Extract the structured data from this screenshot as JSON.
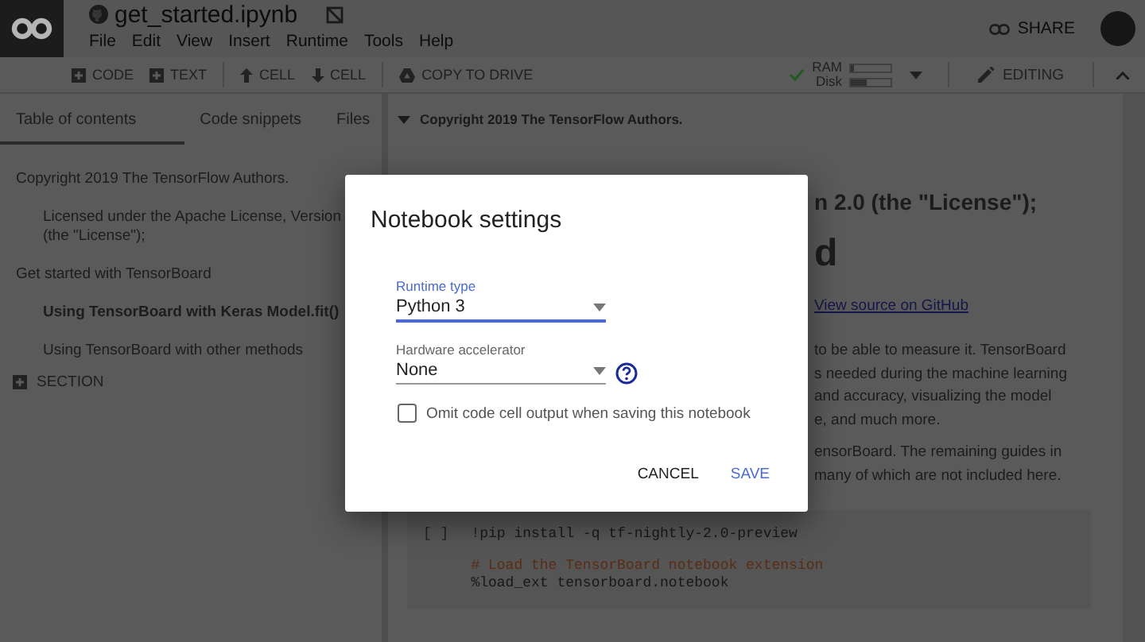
{
  "header": {
    "title": "get_started.ipynb",
    "menu": [
      "File",
      "Edit",
      "View",
      "Insert",
      "Runtime",
      "Tools",
      "Help"
    ],
    "share": "SHARE"
  },
  "toolbar": {
    "items": [
      {
        "kind": "add",
        "label": "CODE"
      },
      {
        "kind": "add",
        "label": "TEXT"
      },
      {
        "kind": "up",
        "label": "CELL"
      },
      {
        "kind": "down",
        "label": "CELL"
      },
      {
        "kind": "drive",
        "label": "COPY TO DRIVE"
      }
    ],
    "connected": true,
    "resources": [
      {
        "label": "RAM",
        "level": 0.05
      },
      {
        "label": "Disk",
        "level": 0.4
      }
    ],
    "mode": "EDITING"
  },
  "sidebar": {
    "tabs": [
      {
        "label": "Table of contents",
        "selected": true
      },
      {
        "label": "Code snippets",
        "selected": false
      },
      {
        "label": "Files",
        "selected": false
      }
    ],
    "toc": [
      {
        "text": "Copyright 2019 The TensorFlow Authors.",
        "selected": false,
        "children": [
          {
            "text": "Licensed under the Apache License, Version\n(the \"License\");",
            "selected": false
          }
        ]
      },
      {
        "text": "Get started with TensorBoard",
        "selected": false,
        "children": [
          {
            "text": "Using TensorBoard with Keras Model.fit()",
            "selected": true
          },
          {
            "text": "Using TensorBoard with other methods",
            "selected": false
          }
        ]
      }
    ],
    "add_section": "SECTION"
  },
  "notebook": {
    "section": {
      "title": "Copyright 2019 The TensorFlow Authors.",
      "expanded": true
    },
    "fragments": [
      {
        "kind": "bold",
        "text": "n 2.0 (the \"License\");"
      },
      {
        "kind": "heading",
        "text": "d"
      },
      {
        "kind": "link",
        "text": "View source on GitHub"
      },
      {
        "kind": "text",
        "text": "to be able to measure it. TensorBoard"
      },
      {
        "kind": "text",
        "text": "s needed during the machine learning"
      },
      {
        "kind": "text",
        "text": "and accuracy, visualizing the model"
      },
      {
        "kind": "text",
        "text": "e, and much more."
      },
      {
        "kind": "gap",
        "text": "ensorBoard. The remaining guides in"
      },
      {
        "kind": "text",
        "text": "many of which are not included here."
      }
    ],
    "code_cell": {
      "marker": "[ ]",
      "lines": [
        {
          "kind": "code",
          "text": "!pip install -q tf-nightly-2.0-preview"
        },
        {
          "kind": "comment",
          "text": "# Load the TensorBoard notebook extension"
        },
        {
          "kind": "code",
          "text": "%load_ext tensorboard.notebook"
        }
      ]
    }
  },
  "dialog": {
    "title": "Notebook settings",
    "fields": [
      {
        "label": "Runtime type",
        "value": "Python 3",
        "focused": true,
        "help": false
      },
      {
        "label": "Hardware accelerator",
        "value": "None",
        "focused": false,
        "help": true
      }
    ],
    "checkbox": {
      "label": "Omit code cell output when saving this notebook",
      "checked": false
    },
    "buttons": [
      {
        "label": "CANCEL",
        "kind": "plain"
      },
      {
        "label": "SAVE",
        "kind": "primary"
      }
    ]
  }
}
